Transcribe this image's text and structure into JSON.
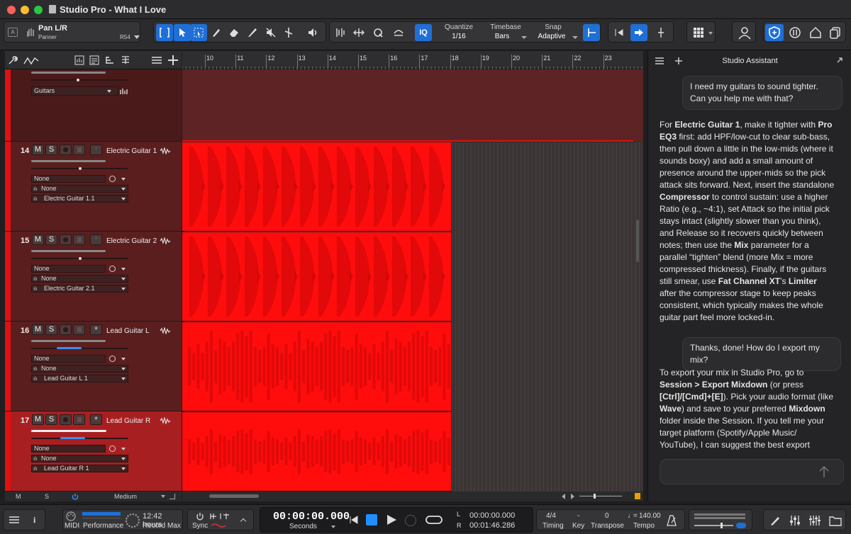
{
  "window": {
    "title": "Studio Pro - What I Love"
  },
  "inspector": {
    "name": "Pan L/R",
    "sub": "Panner",
    "value": "R54"
  },
  "toolbar": {
    "quantize_label": "Quantize",
    "quantize_value": "1/16",
    "timebase_label": "Timebase",
    "timebase_value": "Bars",
    "snap_label": "Snap",
    "snap_value": "Adaptive",
    "iq": "IQ"
  },
  "ruler": {
    "marks": [
      "10",
      "11",
      "12",
      "13",
      "14",
      "15",
      "16",
      "17",
      "18",
      "19",
      "20",
      "21",
      "22",
      "23"
    ]
  },
  "folder": {
    "name": "Guitars"
  },
  "tracks": [
    {
      "num": "14",
      "m": "M",
      "s": "S",
      "name": "Electric Guitar 1",
      "in1": "None",
      "in2": "None",
      "out": "Electric Guitar 1.1"
    },
    {
      "num": "15",
      "m": "M",
      "s": "S",
      "name": "Electric Guitar 2",
      "in1": "None",
      "in2": "None",
      "out": "Electric Guitar 2.1"
    },
    {
      "num": "16",
      "m": "M",
      "s": "S",
      "name": "Lead Guitar L",
      "in1": "None",
      "in2": "None",
      "out": "Lead Guitar L 1"
    },
    {
      "num": "17",
      "m": "M",
      "s": "S",
      "name": "Lead Guitar R",
      "in1": "None",
      "in2": "None",
      "out": "Lead Guitar R 1"
    }
  ],
  "footer_left": {
    "m": "M",
    "s": "S",
    "zoom": "Medium"
  },
  "assistant": {
    "title": "Studio Assistant",
    "q1": "I need my guitars to sound tighter. Can you help me with that?",
    "a1": [
      {
        "t": "For "
      },
      {
        "b": "Electric Guitar 1"
      },
      {
        "t": ", make it tighter with "
      },
      {
        "b": "Pro EQ3"
      },
      {
        "t": " first: add HPF/low-cut to clear sub-bass, then pull down a little in the low-mids (where it sounds boxy) and add a small amount of presence around the upper-mids so the pick attack sits forward. Next, insert the standalone "
      },
      {
        "b": "Compressor"
      },
      {
        "t": " to control sustain: use a higher Ratio (e.g., ~4:1), set Attack so the initial pick stays intact (slightly slower than you think), and Release so it recovers quickly between notes; then use the "
      },
      {
        "b": "Mix"
      },
      {
        "t": " parameter for a parallel “tighten” blend (more Mix = more compressed thickness). Finally, if the guitars still smear, use "
      },
      {
        "b": "Fat Channel XT"
      },
      {
        "t": "’s "
      },
      {
        "b": "Limiter"
      },
      {
        "t": " after the compressor stage to keep peaks consistent, which typically makes the whole guitar part feel more locked-in."
      }
    ],
    "q2": "Thanks, done! How do I export my mix?",
    "a2": [
      {
        "t": "To export your mix in Studio Pro, go to "
      },
      {
        "b": "Session > Export Mixdown"
      },
      {
        "t": " (or press "
      },
      {
        "b": "[Ctrl]/[Cmd]+[E]"
      },
      {
        "t": "). Pick your audio format (like "
      },
      {
        "b": "Wave"
      },
      {
        "t": ") and save to your preferred "
      },
      {
        "b": "Mixdown"
      },
      {
        "t": " folder inside the Session. If you tell me your target platform (Spotify/Apple Music/ YouTube), I can suggest the best export"
      }
    ]
  },
  "transport": {
    "midi": "MIDI",
    "performance": "Performance",
    "record_time": "12:42 hours",
    "record_label": "Record Max",
    "sync": "Sync",
    "time": "00:00:00.000",
    "time_unit": "Seconds",
    "l_time": "00:00:00.000",
    "r_time": "00:01:46.286",
    "l": "L",
    "r": "R",
    "sig": "4/4",
    "timing": "Timing",
    "key": "-",
    "key_label": "Key",
    "transpose": "0",
    "transpose_label": "Transpose",
    "tempo": "140.00",
    "tempo_label": "Tempo"
  },
  "colors": {
    "track": "#e01010",
    "accent": "#1f6fd6",
    "region": "#ff0c0c"
  }
}
